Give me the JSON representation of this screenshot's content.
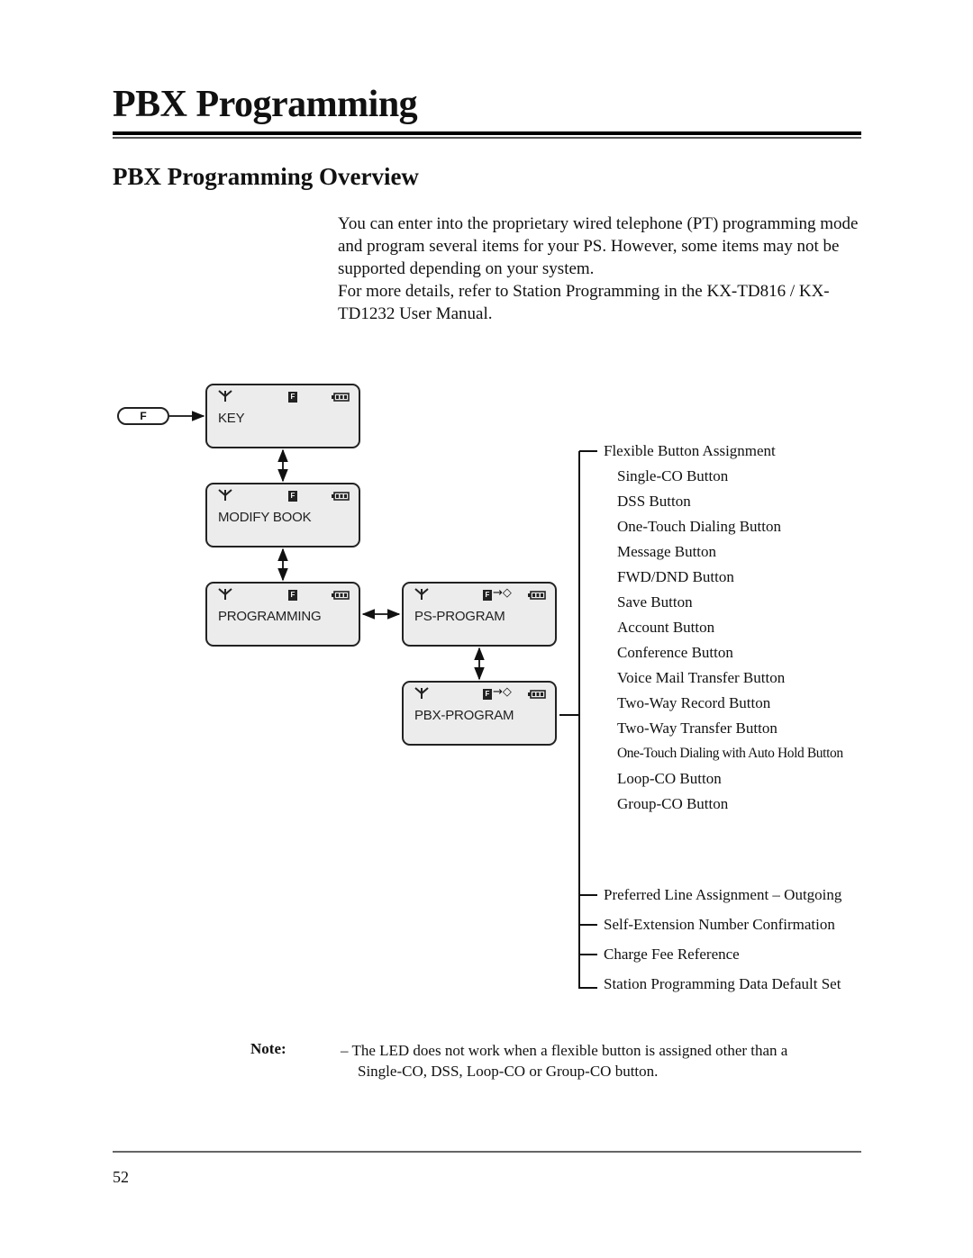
{
  "header": {
    "chapter_title": "PBX Programming",
    "section_title": "PBX Programming Overview"
  },
  "intro": {
    "paragraphs": [
      "You can enter into the proprietary wired telephone (PT) programming mode and program several items for your PS.  However, some items may not be supported depending on your system.",
      "For more details, refer to Station Programming in the KX-TD816 / KX-TD1232 User Manual."
    ]
  },
  "diagram": {
    "f_key_label": "F",
    "screens": [
      {
        "id": "key",
        "text": "KEY",
        "icons": [
          "antenna-icon",
          "f-mode-icon",
          "battery-icon"
        ]
      },
      {
        "id": "modify-book",
        "text": "MODIFY BOOK",
        "icons": [
          "antenna-icon",
          "f-mode-icon",
          "battery-icon"
        ]
      },
      {
        "id": "programming",
        "text": "PROGRAMMING",
        "icons": [
          "antenna-icon",
          "f-mode-icon",
          "battery-icon"
        ]
      },
      {
        "id": "ps-program",
        "text": "PS-PROGRAM",
        "icons": [
          "antenna-icon",
          "f-mode-icon",
          "arrow-enter-icon",
          "battery-icon"
        ]
      },
      {
        "id": "pbx-program",
        "text": "PBX-PROGRAM",
        "icons": [
          "antenna-icon",
          "f-mode-icon",
          "arrow-enter-icon",
          "battery-icon"
        ]
      }
    ],
    "f_glyph": "F",
    "enter_glyph": "→◇",
    "tree": {
      "group_title": "Flexible Button Assignment",
      "sub_items": [
        "Single-CO Button",
        "DSS Button",
        "One-Touch Dialing Button",
        "Message Button",
        "FWD/DND Button",
        "Save Button",
        "Account Button",
        "Conference Button",
        "Voice Mail Transfer Button",
        "Two-Way Record Button",
        "Two-Way Transfer Button",
        "One-Touch Dialing with Auto Hold Button",
        "Loop-CO Button",
        "Group-CO Button"
      ],
      "other_items": [
        "Preferred Line Assignment – Outgoing",
        "Self-Extension Number Confirmation",
        "Charge Fee Reference",
        "Station Programming Data Default Set"
      ]
    }
  },
  "note": {
    "label": "Note:",
    "lines": [
      "– The LED does not work when a flexible button is assigned other than a",
      "Single-CO, DSS, Loop-CO or Group-CO button."
    ]
  },
  "footer": {
    "page_number": "52"
  }
}
